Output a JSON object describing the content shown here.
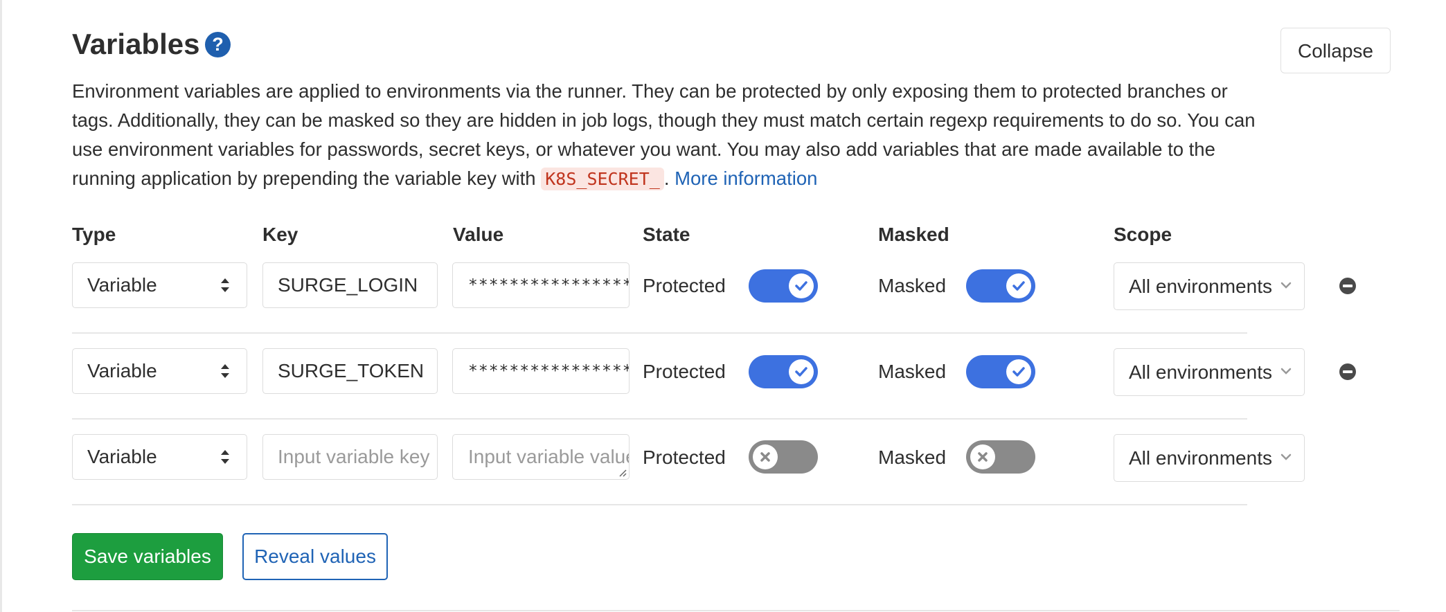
{
  "section": {
    "title": "Variables",
    "help_icon": "question-circle-icon",
    "collapse_label": "Collapse",
    "description": "Environment variables are applied to environments via the runner. They can be protected by only exposing them to protected branches or tags. Additionally, they can be masked so they are hidden in job logs, though they must match certain regexp requirements to do so. You can use environment variables for passwords, secret keys, or whatever you want. You may also add variables that are made available to the running application by prepending the variable key with",
    "code_prefix": "K8S_SECRET_",
    "period": ".",
    "more_info": "More information"
  },
  "headers": {
    "type": "Type",
    "key": "Key",
    "value": "Value",
    "state": "State",
    "masked": "Masked",
    "scope": "Scope"
  },
  "rows": [
    {
      "type": "Variable",
      "key": "SURGE_LOGIN",
      "value": "*****************",
      "state_label": "Protected",
      "protected": true,
      "masked_label": "Masked",
      "masked": true,
      "scope": "All environments"
    },
    {
      "type": "Variable",
      "key": "SURGE_TOKEN",
      "value": "*****************",
      "state_label": "Protected",
      "protected": true,
      "masked_label": "Masked",
      "masked": true,
      "scope": "All environments"
    },
    {
      "type": "Variable",
      "key_placeholder": "Input variable key",
      "value_placeholder": "Input variable value",
      "state_label": "Protected",
      "protected": false,
      "masked_label": "Masked",
      "masked": false,
      "scope": "All environments"
    }
  ],
  "actions": {
    "save": "Save variables",
    "reveal": "Reveal values"
  },
  "colors": {
    "toggle_on": "#3d71e0",
    "toggle_off": "#8a8a8a",
    "save": "#1d9e3f",
    "link": "#1f63b5",
    "code_text": "#c0341d"
  }
}
